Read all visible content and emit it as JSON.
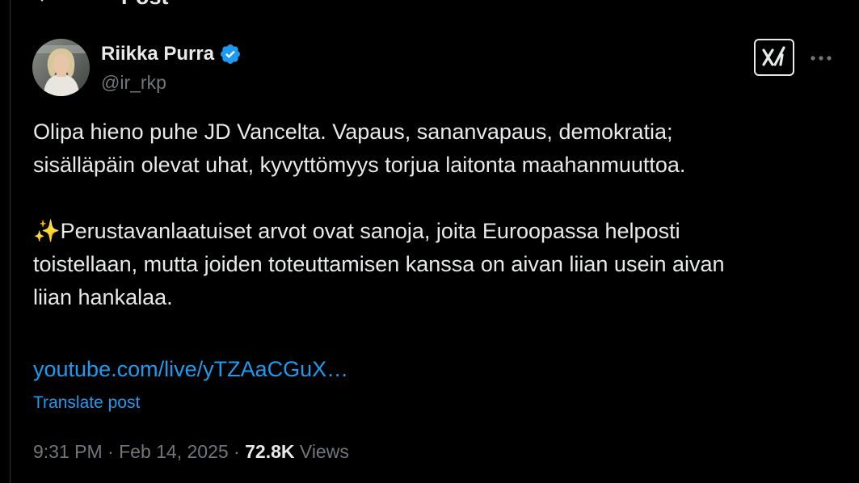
{
  "header": {
    "title": "Post"
  },
  "author": {
    "name": "Riikka Purra",
    "handle": "@ir_rkp",
    "verified": true
  },
  "tweet": {
    "paragraph_1": "Olipa hieno puhe JD Vancelta. Vapaus, sananvapaus, demokratia;\nsisälläpäin olevat uhat, kyvyttömyys torjua laitonta maahanmuuttoa.",
    "paragraph_2": "✨Perustavanlaatuiset arvot ovat sanoja, joita Euroopassa helposti\ntoistellaan, mutta joiden toteuttamisen kanssa on aivan liian usein aivan\nliian hankalaa.",
    "link": "youtube.com/live/yTZAaCGuX…"
  },
  "translate_label": "Translate post",
  "meta": {
    "time": "9:31 PM",
    "separator_1": " · ",
    "date": "Feb 14, 2025",
    "separator_2": " · ",
    "views_count": "72.8K",
    "views_label": " Views"
  },
  "icons": {
    "back": "arrow-left-icon",
    "verified": "verified-badge-icon",
    "grok": "grok-icon",
    "more": "more-horizontal-icon"
  },
  "colors": {
    "background": "#000000",
    "text": "#e7e9ea",
    "secondary": "#71767b",
    "accent": "#1d9bf0",
    "border": "#2f3336"
  }
}
